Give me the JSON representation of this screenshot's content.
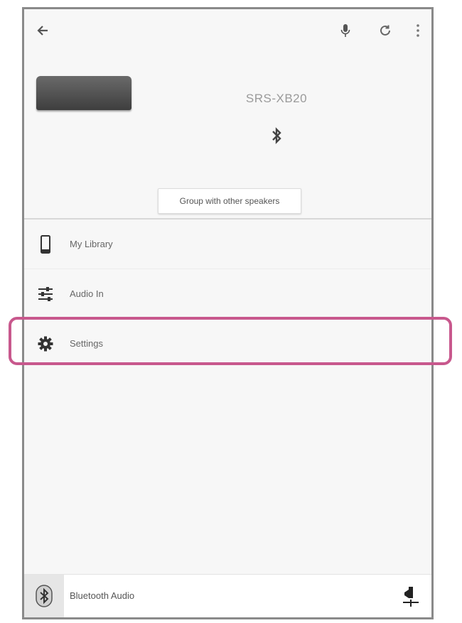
{
  "device": {
    "name": "SRS-XB20",
    "group_button_label": "Group with other speakers"
  },
  "menu": {
    "items": [
      {
        "label": "My Library",
        "icon": "phone-icon"
      },
      {
        "label": "Audio In",
        "icon": "equalizer-icon"
      },
      {
        "label": "Settings",
        "icon": "gear-icon"
      }
    ]
  },
  "bottom_bar": {
    "source_label": "Bluetooth Audio",
    "source_icon": "bluetooth-icon"
  },
  "colors": {
    "highlight": "#c8588d",
    "frame": "#8a8a8a",
    "background": "#f7f7f7"
  }
}
